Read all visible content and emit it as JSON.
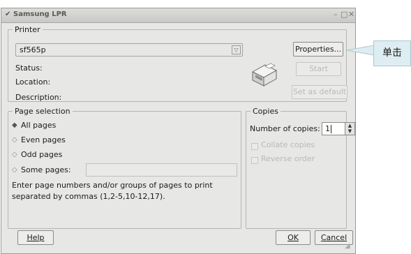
{
  "window": {
    "title": "Samsung LPR"
  },
  "printer": {
    "group_label": "Printer",
    "selected": "sf565p",
    "status_label": "Status:",
    "location_label": "Location:",
    "description_label": "Description:",
    "properties_button": "Properties...",
    "start_button": "Start",
    "set_default_button": "Set as default"
  },
  "page_selection": {
    "group_label": "Page selection",
    "options": [
      "All pages",
      "Even pages",
      "Odd pages",
      "Some pages:"
    ],
    "selected": "All pages",
    "hint_line1": "Enter page numbers and/or groups of pages to print",
    "hint_line2": "separated by commas (1,2-5,10-12,17)."
  },
  "copies": {
    "group_label": "Copies",
    "number_label": "Number of copies:",
    "number_value": "1",
    "collate_label": "Collate copies",
    "reverse_label": "Reverse order"
  },
  "footer": {
    "help": "Help",
    "ok": "OK",
    "cancel": "Cancel"
  },
  "annotation": {
    "text": "单击"
  }
}
